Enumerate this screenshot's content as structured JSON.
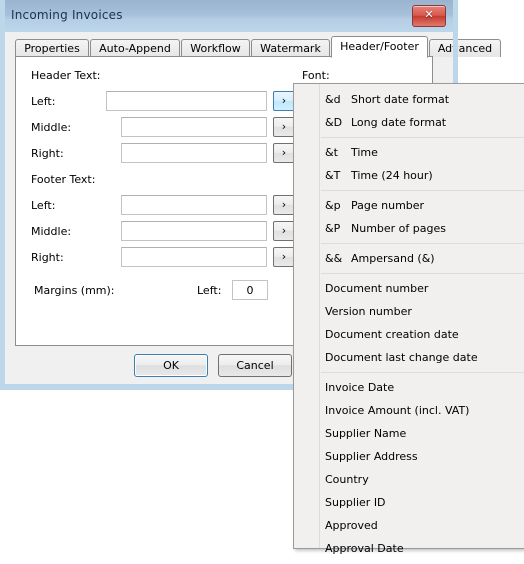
{
  "window": {
    "title": "Incoming Invoices",
    "close_label": "✕"
  },
  "tabs": [
    {
      "label": "Properties",
      "selected": false
    },
    {
      "label": "Auto-Append",
      "selected": false
    },
    {
      "label": "Workflow",
      "selected": false
    },
    {
      "label": "Watermark",
      "selected": false
    },
    {
      "label": "Header/Footer",
      "selected": true
    },
    {
      "label": "Advanced",
      "selected": false
    }
  ],
  "page": {
    "header_section_label": "Header Text:",
    "footer_section_label": "Footer Text:",
    "font_label": "Font:",
    "margins_label": "Margins (mm):",
    "margins_left_label": "Left:",
    "margins_left_value": "0",
    "arrow_glyph": "›",
    "header_fields": [
      {
        "label": "Left:",
        "value": "",
        "placeholder": "",
        "focused": true
      },
      {
        "label": "Middle:",
        "value": "",
        "placeholder": "",
        "focused": false
      },
      {
        "label": "Right:",
        "value": "",
        "placeholder": "",
        "focused": false
      }
    ],
    "footer_fields": [
      {
        "label": "Left:",
        "value": "",
        "placeholder": "",
        "focused": false
      },
      {
        "label": "Middle:",
        "value": "",
        "placeholder": "",
        "focused": false
      },
      {
        "label": "Right:",
        "value": "",
        "placeholder": "",
        "focused": false
      }
    ]
  },
  "buttons": {
    "ok": "OK",
    "cancel": "Cancel"
  },
  "menu": {
    "groups": [
      {
        "items": [
          {
            "code": "&d",
            "label": "Short date format"
          },
          {
            "code": "&D",
            "label": "Long date format"
          }
        ]
      },
      {
        "items": [
          {
            "code": "&t",
            "label": "Time"
          },
          {
            "code": "&T",
            "label": "Time (24 hour)"
          }
        ]
      },
      {
        "items": [
          {
            "code": "&p",
            "label": "Page number"
          },
          {
            "code": "&P",
            "label": "Number of pages"
          }
        ]
      },
      {
        "items": [
          {
            "code": "&&",
            "label": "Ampersand (&)"
          }
        ]
      },
      {
        "items": [
          {
            "code": "",
            "label": "Document number"
          },
          {
            "code": "",
            "label": "Version number"
          },
          {
            "code": "",
            "label": "Document creation date"
          },
          {
            "code": "",
            "label": "Document last change date"
          }
        ]
      },
      {
        "items": [
          {
            "code": "",
            "label": "Invoice Date"
          },
          {
            "code": "",
            "label": "Invoice Amount (incl. VAT)"
          },
          {
            "code": "",
            "label": "Supplier Name"
          },
          {
            "code": "",
            "label": "Supplier Address"
          },
          {
            "code": "",
            "label": "Country"
          },
          {
            "code": "",
            "label": "Supplier ID"
          },
          {
            "code": "",
            "label": "Approved"
          },
          {
            "code": "",
            "label": "Approval Date"
          }
        ]
      }
    ]
  },
  "colors": {
    "titlebar_top": "#9ab4d0",
    "titlebar_bottom": "#bcd6ea",
    "close_red": "#c4392f",
    "focus_blue": "#3c7fb1",
    "menu_bg": "#f1f0ef",
    "client_bg": "#f0f0f0"
  }
}
